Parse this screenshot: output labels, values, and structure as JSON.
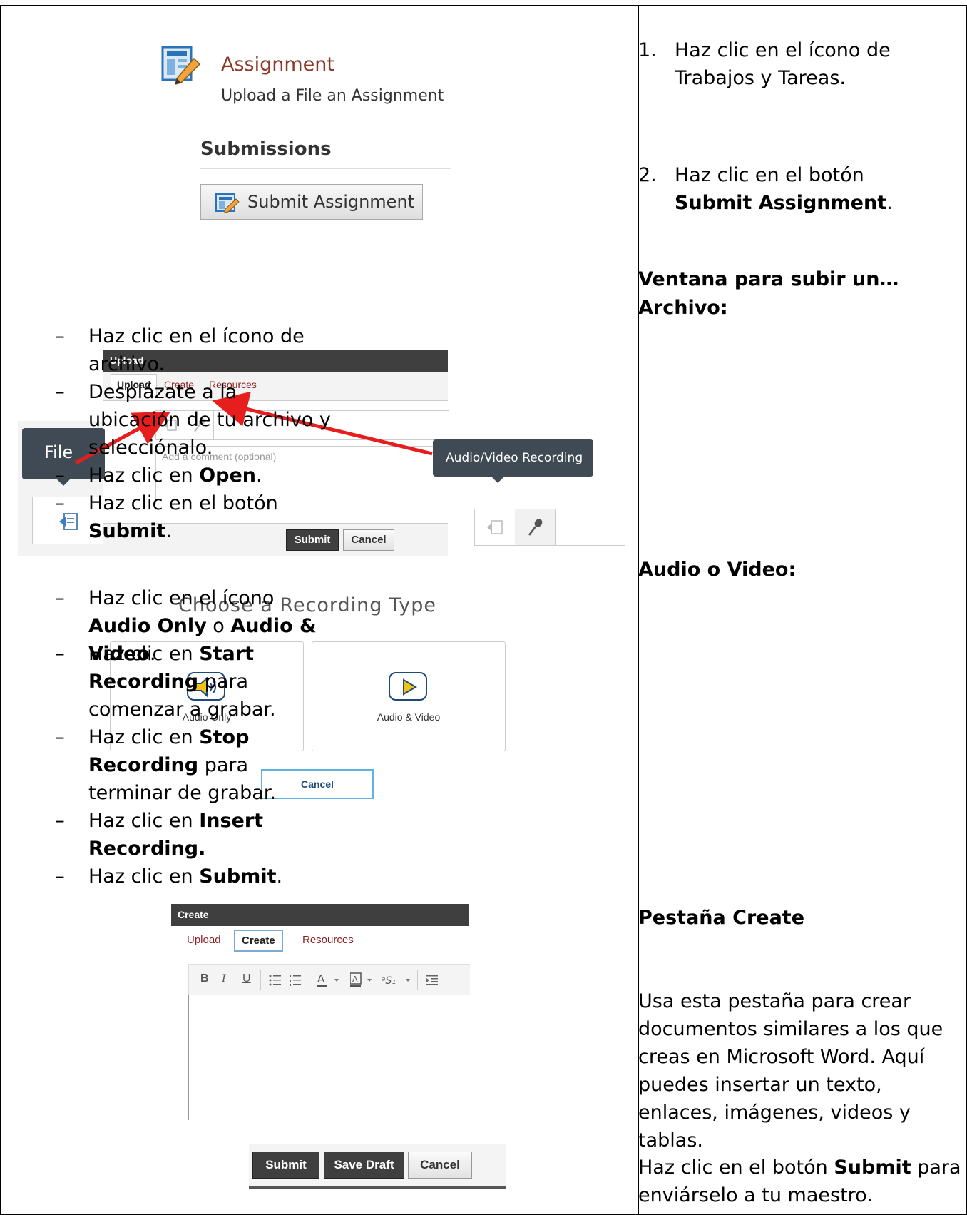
{
  "row1": {
    "assignment_title": "Assignment",
    "assignment_subtitle": "Upload a File an Assignment",
    "step_number": "1.",
    "step_text": "Haz clic en el ícono de Trabajos y Tareas."
  },
  "row2": {
    "submissions_heading": "Submissions",
    "submit_assignment_label": "Submit Assignment",
    "step_number": "2.",
    "step_text_prefix": "Haz clic en el botón",
    "step_text_bold": "Submit Assignment",
    "step_text_suffix": "."
  },
  "row3": {
    "upload_panel": {
      "header": "Upload",
      "tabs": [
        "Upload",
        "Create",
        "Resources"
      ],
      "comment_placeholder": "Add a comment (optional)",
      "submit_label": "Submit",
      "cancel_label": "Cancel"
    },
    "file_tooltip": "File",
    "av_tooltip": "Audio/Video Recording",
    "recording_title": "Choose a Recording Type",
    "audio_only_label": "Audio Only",
    "audio_video_label": "Audio & Video",
    "cancel_label": "Cancel",
    "heading": "Ventana para subir un…",
    "archivo_heading": "Archivo:",
    "archivo_items": [
      {
        "pre": "Haz clic en el ícono de archivo.",
        "bold": "",
        "post": ""
      },
      {
        "pre": "Desplázate a la ubicación de tu archivo y selecciónalo.",
        "bold": "",
        "post": ""
      },
      {
        "pre": "Haz clic en ",
        "bold": "Open",
        "post": "."
      },
      {
        "pre": "Haz clic en el botón ",
        "bold": "Submit",
        "post": "."
      }
    ],
    "av_heading": "Audio o Video:",
    "av_items": [
      {
        "pre": "Haz clic en el ícono ",
        "bold": "Audio Only",
        "mid": " o ",
        "bold2": "Audio & Video",
        "post": "."
      },
      {
        "pre": "Haz clic en ",
        "bold": "Start Recording",
        "post": " para comenzar a grabar."
      },
      {
        "pre": "Haz clic en ",
        "bold": "Stop Recording",
        "post": " para terminar de grabar."
      },
      {
        "pre": "Haz clic en ",
        "bold": "Insert Recording.",
        "post": ""
      },
      {
        "pre": "Haz clic en ",
        "bold": "Submit",
        "post": "."
      }
    ],
    "dash_char": "–"
  },
  "row4": {
    "create_panel": {
      "header": "Create",
      "tabs": [
        "Upload",
        "Create",
        "Resources"
      ],
      "toolbar": [
        "B",
        "I",
        "U"
      ],
      "submit_label": "Submit",
      "save_draft_label": "Save Draft",
      "cancel_label": "Cancel"
    },
    "heading": "Pestaña Create",
    "paragraph": "Usa esta pestaña para crear documentos similares a los que creas en Microsoft Word. Aquí puedes insertar un texto, enlaces, imágenes, videos y tablas.",
    "final_pre": "Haz clic en el botón ",
    "final_bold": "Submit",
    "final_post": " para enviárselo a tu maestro."
  },
  "colors": {
    "accent_link": "#8b1e1e",
    "dark_bar": "#3f3f3f",
    "arrow": "#e61e1e",
    "icon_yellow": "#f2c21b",
    "icon_blue": "#1e4a7a"
  }
}
